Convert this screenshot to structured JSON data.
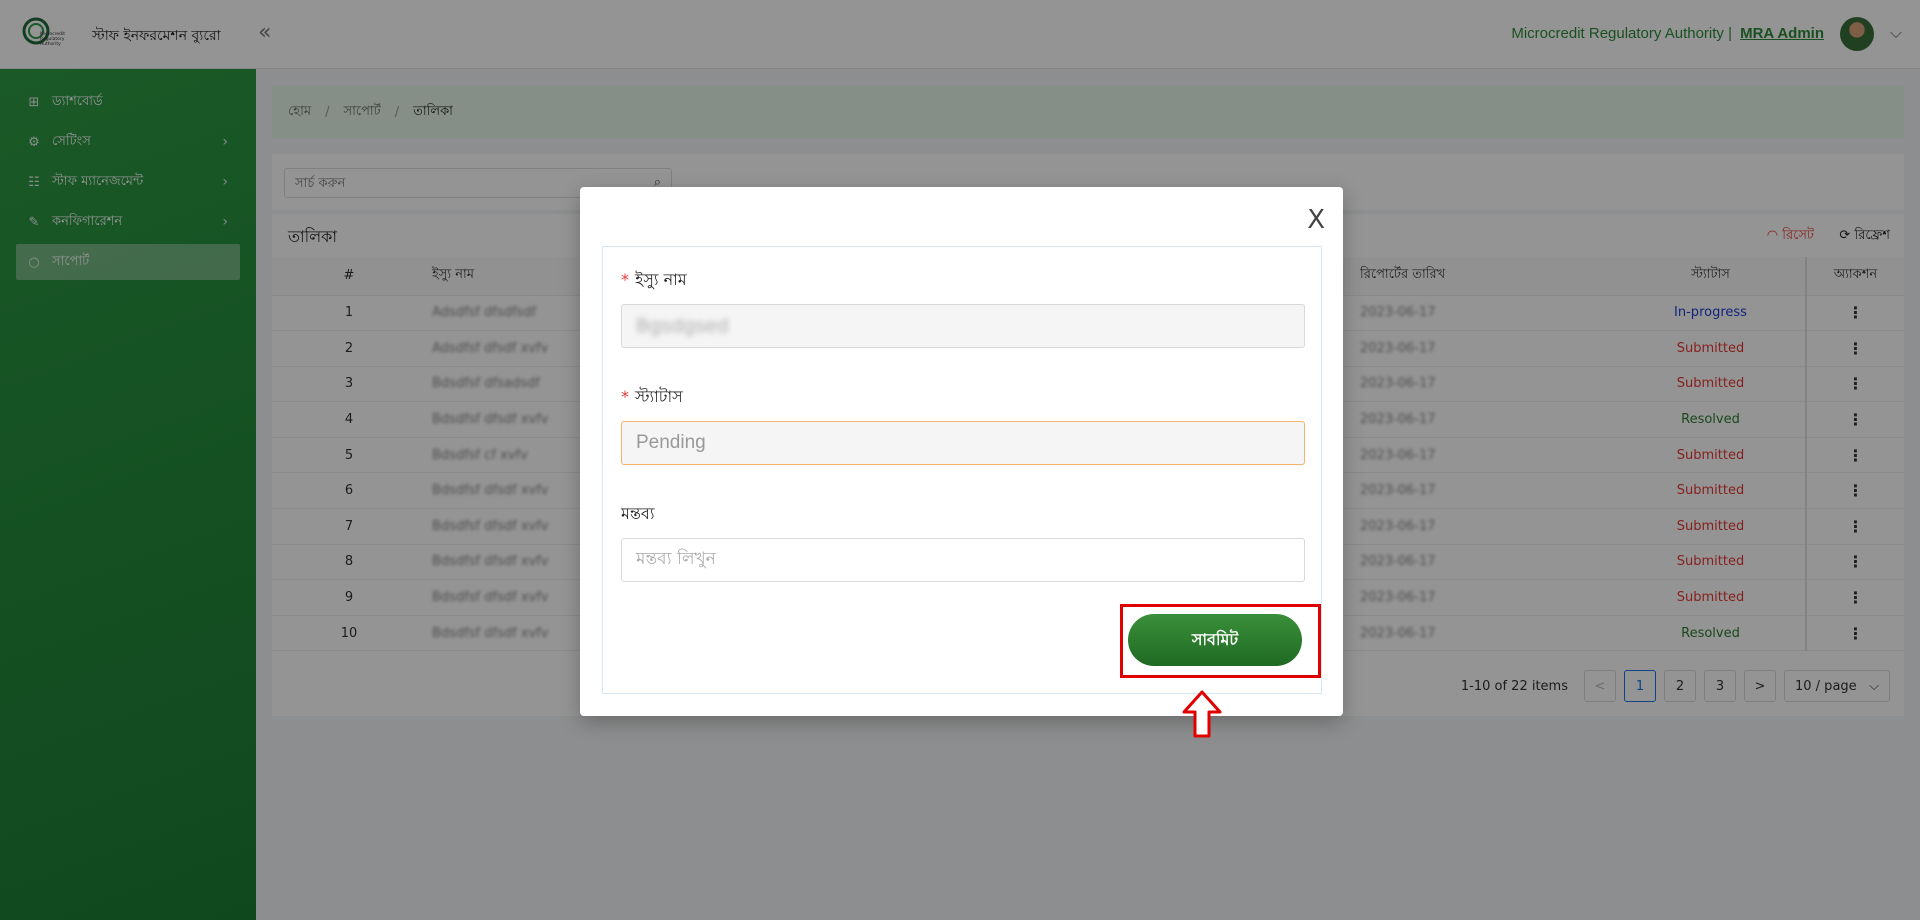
{
  "header": {
    "brand": "স্টাফ ইনফরমেশন ব্যুরো",
    "logo_text": "Microcredit Regulatory Authority",
    "collapse_icon": "«",
    "org_name": "Microcredit Regulatory Authority |",
    "user_name": "MRA Admin",
    "chevron": "⌵"
  },
  "sidebar": {
    "items": [
      {
        "label": "ড্যাশবোর্ড",
        "icon": "⊞"
      },
      {
        "label": "সেটিংস",
        "icon": "⚙",
        "arrow": "›"
      },
      {
        "label": "স্টাফ ম্যানেজমেন্ট",
        "icon": "☷",
        "arrow": "›"
      },
      {
        "label": "কনফিগারেশন",
        "icon": "✎",
        "arrow": "›"
      },
      {
        "label": "সাপোর্ট",
        "icon": "○"
      }
    ]
  },
  "breadcrumb": {
    "home": "হোম",
    "sep": "/",
    "support": "সাপোর্ট",
    "current": "তালিকা"
  },
  "search": {
    "placeholder": "সার্চ করুন",
    "icon": "⌕"
  },
  "table": {
    "title": "তালিকা",
    "reset": "রিসেট",
    "reset_icon": "◠",
    "refresh": "রিফ্রেশ",
    "refresh_icon": "⟳",
    "columns": [
      "#",
      "ইস্যু নাম",
      "",
      "রিপোর্টের তারিখ",
      "স্ট্যাটাস",
      "অ্যাকশন"
    ],
    "rows": [
      {
        "num": "1",
        "name": "Adsdfsf dfsdfsdf",
        "date": "2023-06-17",
        "status": "In-progress",
        "action": "⋮"
      },
      {
        "num": "2",
        "name": "Adsdfsf dfsdf xvfv",
        "date": "2023-06-17",
        "status": "Submitted",
        "action": "⋮"
      },
      {
        "num": "3",
        "name": "Bdsdfsf dfsadsdf",
        "date": "2023-06-17",
        "status": "Submitted",
        "action": "⋮"
      },
      {
        "num": "4",
        "name": "Bdsdfsf dfsdf xvfv",
        "date": "2023-06-17",
        "status": "Resolved",
        "action": "⋮"
      },
      {
        "num": "5",
        "name": "Bdsdfsf cf xvfv",
        "date": "2023-06-17",
        "status": "Submitted",
        "action": "⋮"
      },
      {
        "num": "6",
        "name": "Bdsdfsf dfsdf xvfv",
        "date": "2023-06-17",
        "status": "Submitted",
        "action": "⋮"
      },
      {
        "num": "7",
        "name": "Bdsdfsf dfsdf xvfv",
        "date": "2023-06-17",
        "status": "Submitted",
        "action": "⋮"
      },
      {
        "num": "8",
        "name": "Bdsdfsf dfsdf xvfv",
        "date": "2023-06-17",
        "status": "Submitted",
        "action": "⋮"
      },
      {
        "num": "9",
        "name": "Bdsdfsf dfsdf xvfv",
        "date": "2023-06-17",
        "status": "Submitted",
        "action": "⋮"
      },
      {
        "num": "10",
        "name": "Bdsdfsf dfsdf xvfv",
        "date": "2023-06-17",
        "status": "Resolved",
        "action": "⋮"
      }
    ]
  },
  "pagination": {
    "total": "1-10 of 22 items",
    "prev": "<",
    "pages": [
      "1",
      "2",
      "3"
    ],
    "next": ">",
    "page_size": "10 / page",
    "page_size_icon": "⌵"
  },
  "modal": {
    "close": "X",
    "required_mark": "*",
    "issue_label": "ইস্যু নাম",
    "issue_value": "Bgsdgsed",
    "status_label": "স্ট্যাটাস",
    "status_value": "Pending",
    "comment_label": "মন্তব্য",
    "comment_placeholder": "মন্তব্য লিখুন",
    "submit_label": "সাবমিট"
  },
  "colors": {
    "sidebar_green": "#238a3b",
    "submit_green": "#2e7d32",
    "highlight_red": "#e10000"
  }
}
